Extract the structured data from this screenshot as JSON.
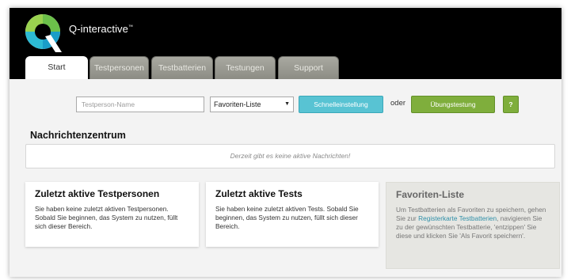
{
  "brand": {
    "name": "Q-interactive",
    "tm": "™"
  },
  "tabs": [
    {
      "label": "Start",
      "active": true
    },
    {
      "label": "Testpersonen",
      "active": false
    },
    {
      "label": "Testbatterien",
      "active": false
    },
    {
      "label": "Testungen",
      "active": false
    },
    {
      "label": "Support",
      "active": false
    }
  ],
  "search": {
    "placeholder": "Testperson-Name",
    "dropdown_value": "Favoriten-Liste",
    "quick_button": "Schnelleinstellung",
    "or_label": "oder",
    "practice_button": "Übungstestung",
    "help_button": "?"
  },
  "message_center": {
    "title": "Nachrichtenzentrum",
    "empty_text": "Derzeit gibt es keine aktive Nachrichten!"
  },
  "cards": {
    "recent_persons": {
      "title": "Zuletzt aktive Testpersonen",
      "text": "Sie haben keine zuletzt aktiven Testpersonen. Sobald Sie beginnen, das System zu nutzen, füllt sich dieser Bereich."
    },
    "recent_tests": {
      "title": "Zuletzt aktive Tests",
      "text": "Sie haben keine zuletzt aktiven Tests. Sobald Sie beginnen, das System zu nutzen, füllt sich dieser Bereich."
    },
    "favorites": {
      "title": "Favoriten-Liste",
      "text_before": "Um Testbatterien als Favoriten zu speichern, gehen Sie zur ",
      "link": "Registerkarte Testbatterien",
      "text_after": ", navigieren Sie zu der gewünschten Testbatterie, 'entzippen' Sie diese und klicken Sie 'Als Favorit speichern'."
    }
  },
  "colors": {
    "topbar": "#000000",
    "quick_button": "#58c3d3",
    "practice_button": "#7fae3c",
    "link": "#2f8fa8"
  }
}
